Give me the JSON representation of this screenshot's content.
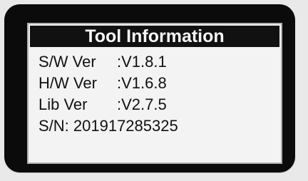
{
  "title": "Tool Information",
  "rows": [
    {
      "label": "S/W Ver",
      "value": ":V1.8.1"
    },
    {
      "label": "H/W Ver",
      "value": ":V1.6.8"
    },
    {
      "label": "Lib Ver",
      "value": ":V2.7.5"
    }
  ],
  "serial": {
    "text": "S/N: 201917285325"
  }
}
